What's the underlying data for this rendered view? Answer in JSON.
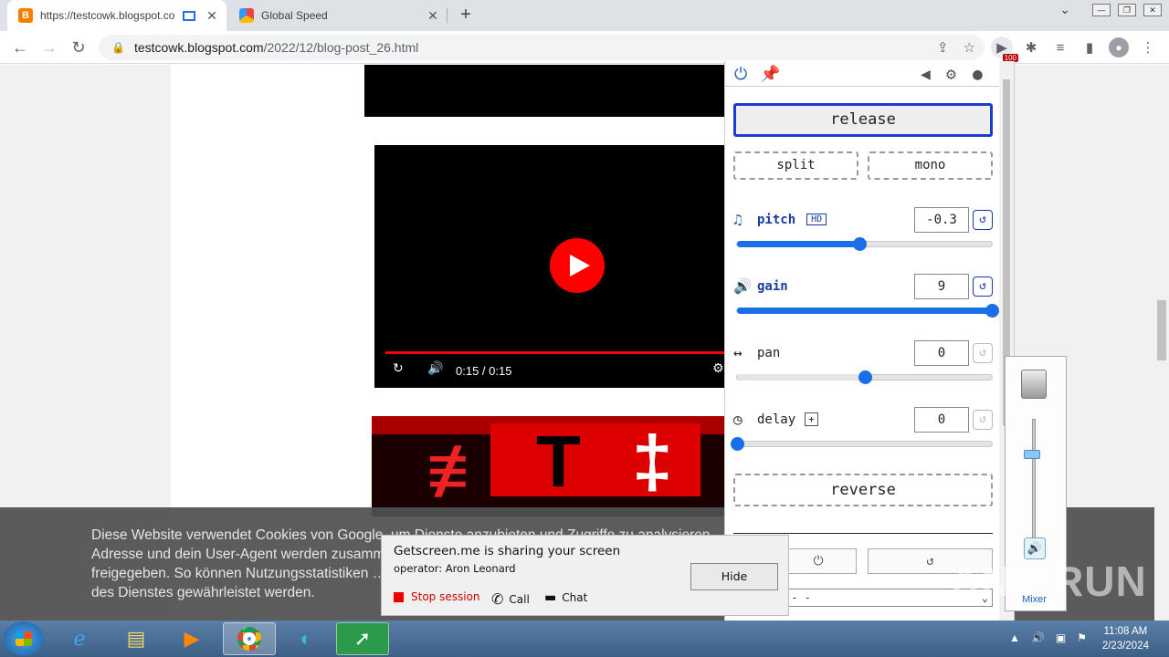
{
  "browser": {
    "tabs": [
      {
        "title": "https://testcowk.blogspot.co",
        "favicon": "blogger-icon",
        "active": true
      },
      {
        "title": "Global Speed",
        "favicon": "global-speed-icon",
        "active": false
      }
    ],
    "url_host": "testcowk.blogspot.com",
    "url_path": "/2022/12/blog-post_26.html",
    "extension_badge": "100"
  },
  "video": {
    "time": "0:15 / 0:15"
  },
  "cookie_banner": {
    "text": "Diese Website verwendet Cookies von Google, um Dienste anzubieten und Zugriffe zu analysieren.\nAdresse und dein User-Agent werden zusammen …\nfreigegeben. So können Nutzungsstatistiken …\ndes Dienstes gewährleistet werden."
  },
  "global_speed": {
    "release": "release",
    "split": "split",
    "mono": "mono",
    "pitch": {
      "label": "pitch",
      "hd": "HD",
      "value": "-0.3",
      "fraction": 0.48
    },
    "gain": {
      "label": "gain",
      "value": "9",
      "fraction": 1.0
    },
    "pan": {
      "label": "pan",
      "value": "0",
      "fraction": 0.5
    },
    "delay": {
      "label": "delay",
      "plus": "+",
      "value": "0",
      "fraction": 0.0
    },
    "reverse": "reverse",
    "select_value": "-- -"
  },
  "screenshare": {
    "title": "Getscreen.me is sharing your screen",
    "operator": "operator: Aron Leonard",
    "hide": "Hide",
    "stop": "Stop session",
    "call": "Call",
    "chat": "Chat"
  },
  "mixer": {
    "label": "Mixer"
  },
  "watermark": "ANY RUN",
  "taskbar": {
    "time": "11:08 AM",
    "date": "2/23/2024"
  },
  "colors": {
    "accent": "#1a6fe8",
    "youtube_red": "#ff0000",
    "release_border": "#1a3ccf"
  }
}
